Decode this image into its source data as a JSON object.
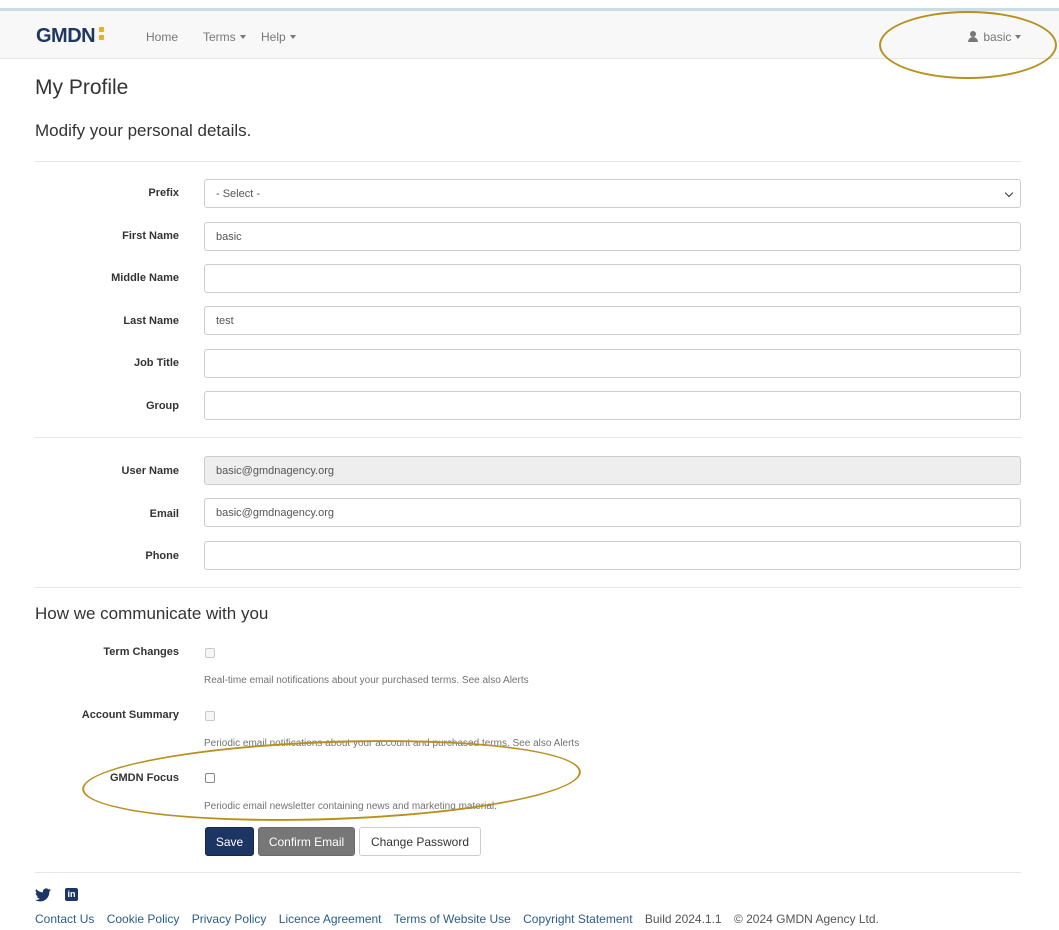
{
  "navbar": {
    "brand": "GMDN",
    "links": [
      "Home",
      "Terms",
      "Help"
    ],
    "user": "basic"
  },
  "page": {
    "title": "My Profile",
    "subtitle": "Modify your personal details.",
    "communication_heading": "How we communicate with you"
  },
  "form": {
    "prefix": {
      "label": "Prefix",
      "selected": "- Select -"
    },
    "first_name": {
      "label": "First Name",
      "value": "basic"
    },
    "middle_name": {
      "label": "Middle Name",
      "value": ""
    },
    "last_name": {
      "label": "Last Name",
      "value": "test"
    },
    "job_title": {
      "label": "Job Title",
      "value": ""
    },
    "group": {
      "label": "Group",
      "value": ""
    },
    "user_name": {
      "label": "User Name",
      "value": "basic@gmdnagency.org"
    },
    "email": {
      "label": "Email",
      "value": "basic@gmdnagency.org"
    },
    "phone": {
      "label": "Phone",
      "value": ""
    }
  },
  "communication": {
    "term_changes": {
      "label": "Term Changes",
      "help": "Real-time email notifications about your purchased terms. See also Alerts",
      "checked": false,
      "disabled": true
    },
    "account_summary": {
      "label": "Account Summary",
      "help": "Periodic email notifications about your account and purchased terms. See also Alerts",
      "checked": false,
      "disabled": true
    },
    "gmdn_focus": {
      "label": "GMDN Focus",
      "help": "Periodic email newsletter containing news and marketing material.",
      "checked": false,
      "disabled": false
    }
  },
  "buttons": {
    "save": "Save",
    "confirm_email": "Confirm Email",
    "change_password": "Change Password"
  },
  "footer": {
    "social": [
      "twitter-icon",
      "linkedin-icon"
    ],
    "links": [
      "Contact Us",
      "Cookie Policy",
      "Privacy Policy",
      "Licence Agreement",
      "Terms of Website Use",
      "Copyright Statement"
    ],
    "build": "Build 2024.1.1",
    "copyright": "© 2024 GMDN Agency Ltd."
  },
  "colors": {
    "brand_navy": "#1c3562",
    "brand_yellow": "#e8b021",
    "annotation": "#b8901f",
    "link": "#2a5d8c"
  }
}
